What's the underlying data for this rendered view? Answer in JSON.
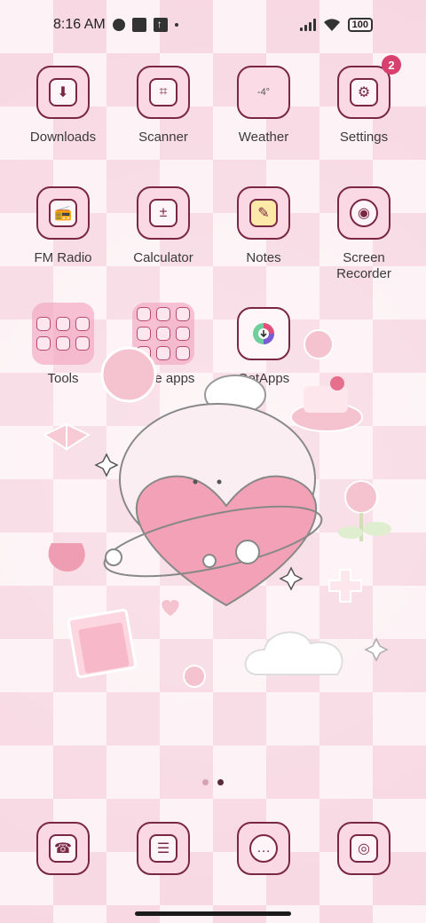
{
  "status_bar": {
    "time": "8:16 AM",
    "battery": "100"
  },
  "apps": [
    {
      "name": "Downloads",
      "icon": "downloads-icon",
      "glyph": "⬇"
    },
    {
      "name": "Scanner",
      "icon": "scanner-icon",
      "glyph": "⌗"
    },
    {
      "name": "Weather",
      "icon": "weather-icon",
      "glyph": "-4°"
    },
    {
      "name": "Settings",
      "icon": "settings-icon",
      "glyph": "⚙",
      "badge": "2"
    },
    {
      "name": "FM Radio",
      "icon": "radio-icon",
      "glyph": "📻"
    },
    {
      "name": "Calculator",
      "icon": "calculator-icon",
      "glyph": "±"
    },
    {
      "name": "Notes",
      "icon": "notes-icon",
      "glyph": "✎"
    },
    {
      "name": "Screen Recorder",
      "icon": "screen-recorder-icon",
      "glyph": "◉"
    },
    {
      "name": "Tools",
      "icon": "tools-folder-icon"
    },
    {
      "name": "More apps",
      "icon": "more-apps-folder-icon"
    },
    {
      "name": "GetApps",
      "icon": "getapps-icon",
      "glyph": "⬇"
    }
  ],
  "dock": [
    {
      "icon": "phone-icon",
      "glyph": "☎"
    },
    {
      "icon": "contacts-icon",
      "glyph": "☰"
    },
    {
      "icon": "messages-icon",
      "glyph": "…"
    },
    {
      "icon": "camera-icon",
      "glyph": "◎"
    }
  ],
  "colors": {
    "accent": "#7a2744",
    "badge": "#d8406f",
    "tile_bg": "#fbd9e4",
    "page_dot_active": "#5a2a3a",
    "page_dot_inactive": "#d4a4b4"
  }
}
